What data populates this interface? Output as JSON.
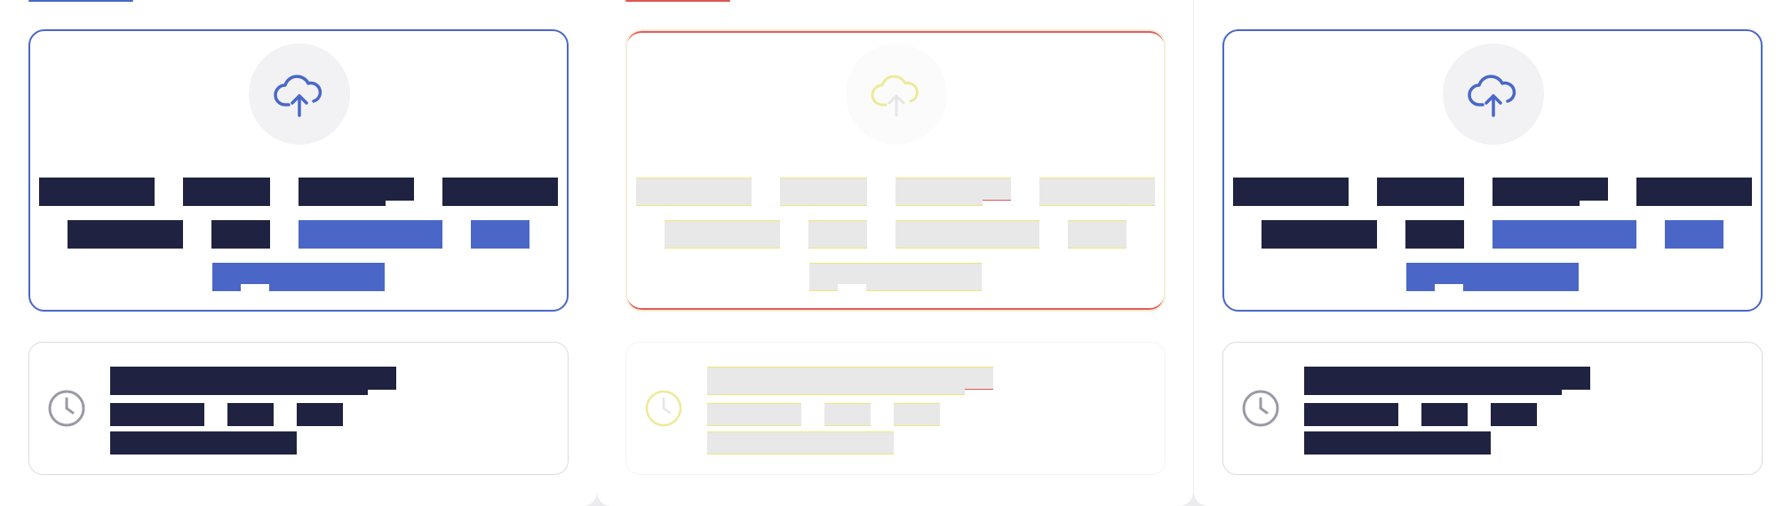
{
  "colors": {
    "accent": "#4a67c8",
    "text_dark": "#1f2240",
    "warning": "#e05454",
    "highlight": "#eee77a"
  },
  "panels": [
    {
      "state": "default",
      "upload": {
        "icon": "cloud-upload-icon",
        "line1": [
          "",
          "",
          "",
          ""
        ],
        "line2": [
          "",
          "",
          "",
          ""
        ],
        "line3": [
          ""
        ]
      },
      "info": {
        "icon": "clock-icon",
        "title": "",
        "meta": [
          "",
          "",
          ""
        ],
        "detail": ""
      }
    },
    {
      "state": "loading",
      "upload": {
        "icon": "cloud-upload-icon",
        "line1": [
          "",
          "",
          "",
          ""
        ],
        "line2": [
          "",
          "",
          "",
          ""
        ],
        "line3": [
          ""
        ]
      },
      "info": {
        "icon": "clock-icon",
        "title": "",
        "meta": [
          "",
          "",
          ""
        ],
        "detail": ""
      }
    },
    {
      "state": "default",
      "upload": {
        "icon": "cloud-upload-icon",
        "line1": [
          "",
          "",
          "",
          ""
        ],
        "line2": [
          "",
          "",
          "",
          ""
        ],
        "line3": [
          ""
        ]
      },
      "info": {
        "icon": "clock-icon",
        "title": "",
        "meta": [
          "",
          "",
          ""
        ],
        "detail": ""
      }
    }
  ]
}
